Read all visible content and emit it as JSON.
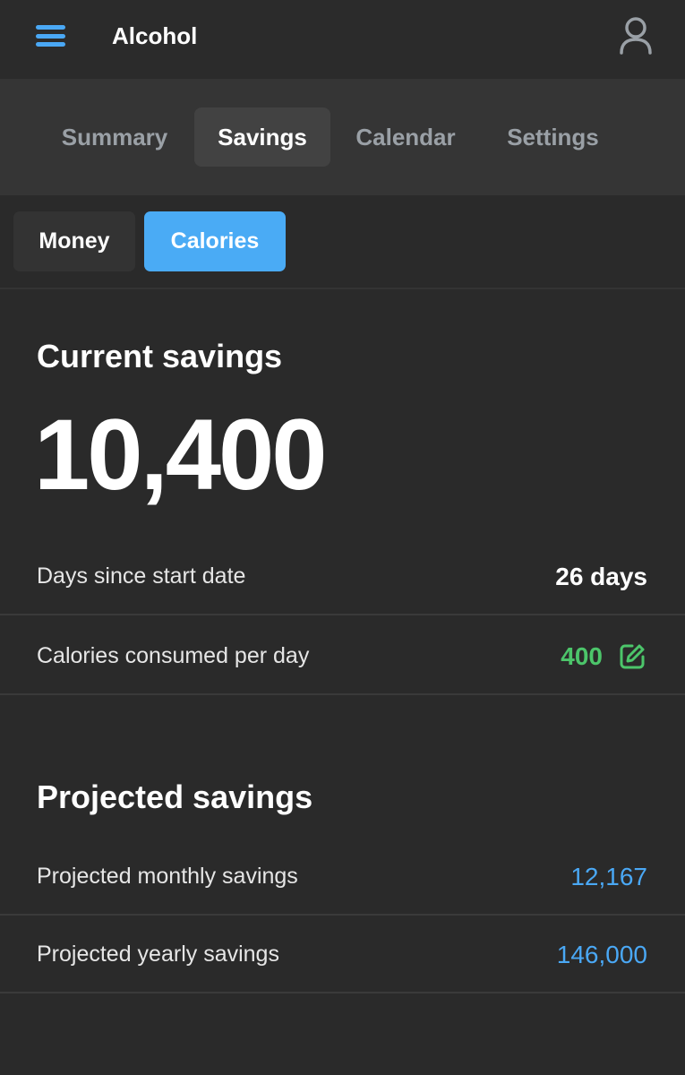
{
  "header": {
    "title": "Alcohol",
    "icons": {
      "menu": "hamburger-menu-icon",
      "profile": "user-icon"
    },
    "accent_color": "#4aa8f5"
  },
  "tabs": [
    {
      "label": "Summary",
      "active": false
    },
    {
      "label": "Savings",
      "active": true
    },
    {
      "label": "Calendar",
      "active": false
    },
    {
      "label": "Settings",
      "active": false
    }
  ],
  "subtabs": [
    {
      "label": "Money",
      "active": false
    },
    {
      "label": "Calories",
      "active": true
    }
  ],
  "current": {
    "title": "Current savings",
    "value": "10,400",
    "rows": [
      {
        "label": "Days since start date",
        "value": "26 days"
      },
      {
        "label": "Calories consumed per day",
        "value": "400",
        "color": "#4cc56a",
        "icon": "edit-icon"
      }
    ]
  },
  "projected": {
    "title": "Projected savings",
    "rows": [
      {
        "label": "Projected monthly savings",
        "value": "12,167",
        "color": "#4aa8f5"
      },
      {
        "label": "Projected yearly savings",
        "value": "146,000",
        "color": "#4aa8f5"
      }
    ]
  }
}
